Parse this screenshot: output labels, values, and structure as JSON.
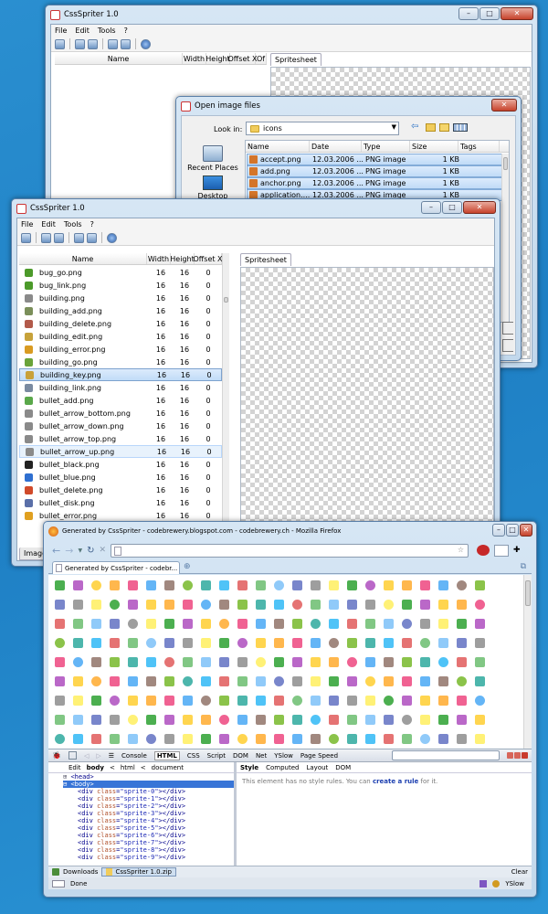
{
  "back_window": {
    "title": "CssSpriter 1.0",
    "menu": [
      "File",
      "Edit",
      "Tools",
      "?"
    ],
    "columns": [
      "Name",
      "Width",
      "Height",
      "Offset X",
      "Of"
    ],
    "spritesheet_tab": "Spritesheet"
  },
  "dialog": {
    "title": "Open image files",
    "look_in_label": "Look in:",
    "folder": "icons",
    "places": [
      "Recent Places",
      "Desktop"
    ],
    "columns": [
      "Name",
      "Date",
      "Type",
      "Size",
      "Tags"
    ],
    "files": [
      {
        "name": "accept.png",
        "date": "12.03.2006 ...",
        "type": "PNG image",
        "size": "1 KB"
      },
      {
        "name": "add.png",
        "date": "12.03.2006 ...",
        "type": "PNG image",
        "size": "1 KB"
      },
      {
        "name": "anchor.png",
        "date": "12.03.2006 ...",
        "type": "PNG image",
        "size": "1 KB"
      },
      {
        "name": "application....",
        "date": "12.03.2006 ...",
        "type": "PNG image",
        "size": "1 KB"
      }
    ]
  },
  "main_window": {
    "title": "CssSpriter 1.0",
    "menu": [
      "File",
      "Edit",
      "Tools",
      "?"
    ],
    "columns": [
      "Name",
      "Width",
      "Height",
      "Offset X"
    ],
    "spritesheet_tab": "Spritesheet",
    "images_tab": "Images",
    "rows": [
      {
        "name": "bug_go.png",
        "w": "16",
        "h": "16",
        "x": "0",
        "color": "#4c9a2a"
      },
      {
        "name": "bug_link.png",
        "w": "16",
        "h": "16",
        "x": "0",
        "color": "#4c9a2a"
      },
      {
        "name": "building.png",
        "w": "16",
        "h": "16",
        "x": "0",
        "color": "#8a8a8a"
      },
      {
        "name": "building_add.png",
        "w": "16",
        "h": "16",
        "x": "0",
        "color": "#7b8f5a"
      },
      {
        "name": "building_delete.png",
        "w": "16",
        "h": "16",
        "x": "0",
        "color": "#b25a4a"
      },
      {
        "name": "building_edit.png",
        "w": "16",
        "h": "16",
        "x": "0",
        "color": "#c7a23a"
      },
      {
        "name": "building_error.png",
        "w": "16",
        "h": "16",
        "x": "0",
        "color": "#d99b22"
      },
      {
        "name": "building_go.png",
        "w": "16",
        "h": "16",
        "x": "0",
        "color": "#6aa33a"
      },
      {
        "name": "building_key.png",
        "w": "16",
        "h": "16",
        "x": "0",
        "color": "#c9a13a"
      },
      {
        "name": "building_link.png",
        "w": "16",
        "h": "16",
        "x": "0",
        "color": "#7a8aa0"
      },
      {
        "name": "bullet_add.png",
        "w": "16",
        "h": "16",
        "x": "0",
        "color": "#5aa84a"
      },
      {
        "name": "bullet_arrow_bottom.png",
        "w": "16",
        "h": "16",
        "x": "0",
        "color": "#8a8a8a"
      },
      {
        "name": "bullet_arrow_down.png",
        "w": "16",
        "h": "16",
        "x": "0",
        "color": "#8a8a8a"
      },
      {
        "name": "bullet_arrow_top.png",
        "w": "16",
        "h": "16",
        "x": "0",
        "color": "#8a8a8a"
      },
      {
        "name": "bullet_arrow_up.png",
        "w": "16",
        "h": "16",
        "x": "0",
        "color": "#8a8a8a"
      },
      {
        "name": "bullet_black.png",
        "w": "16",
        "h": "16",
        "x": "0",
        "color": "#222222"
      },
      {
        "name": "bullet_blue.png",
        "w": "16",
        "h": "16",
        "x": "0",
        "color": "#2f6fd0"
      },
      {
        "name": "bullet_delete.png",
        "w": "16",
        "h": "16",
        "x": "0",
        "color": "#d04a2a"
      },
      {
        "name": "bullet_disk.png",
        "w": "16",
        "h": "16",
        "x": "0",
        "color": "#5a6fa8"
      },
      {
        "name": "bullet_error.png",
        "w": "16",
        "h": "16",
        "x": "0",
        "color": "#e0a020"
      }
    ]
  },
  "firefox": {
    "title": "Generated by CssSpriter - codebrewery.blogspot.com - codebrewery.ch - Mozilla Firefox",
    "tab_label": "Generated by CssSpriter - codebr...",
    "firebug": {
      "toolbar": [
        "Console",
        "HTML",
        "CSS",
        "Script",
        "DOM",
        "Net",
        "YSlow",
        "Page Speed"
      ],
      "edit_label": "Edit",
      "breadcrumb": [
        "body",
        "html",
        "document"
      ],
      "side_tabs": [
        "Style",
        "Computed",
        "Layout",
        "DOM"
      ],
      "head_tag": "<head>",
      "body_tag": "<body>",
      "code_lines": [
        {
          "cls": "sprite-0"
        },
        {
          "cls": "sprite-1"
        },
        {
          "cls": "sprite-2"
        },
        {
          "cls": "sprite-3"
        },
        {
          "cls": "sprite-4"
        },
        {
          "cls": "sprite-5"
        },
        {
          "cls": "sprite-6"
        },
        {
          "cls": "sprite-7"
        },
        {
          "cls": "sprite-8"
        },
        {
          "cls": "sprite-9"
        }
      ],
      "style_msg_prefix": "This element has no style rules. You can ",
      "style_msg_link": "create a rule",
      "style_msg_suffix": " for it."
    },
    "downloads_label": "Downloads",
    "download_file": "CssSpriter 1.0.zip",
    "clear_label": "Clear",
    "status": "Done",
    "yslow": "YSlow"
  },
  "icon_colors": [
    "#4caf50",
    "#8bc34a",
    "#9e9e9e",
    "#64b5f6",
    "#90caf9",
    "#ffb74d",
    "#e57373",
    "#ba68c8",
    "#4db6ac",
    "#fff176",
    "#a1887f",
    "#7986cb",
    "#f06292",
    "#81c784",
    "#ffd54f",
    "#4fc3f7"
  ]
}
